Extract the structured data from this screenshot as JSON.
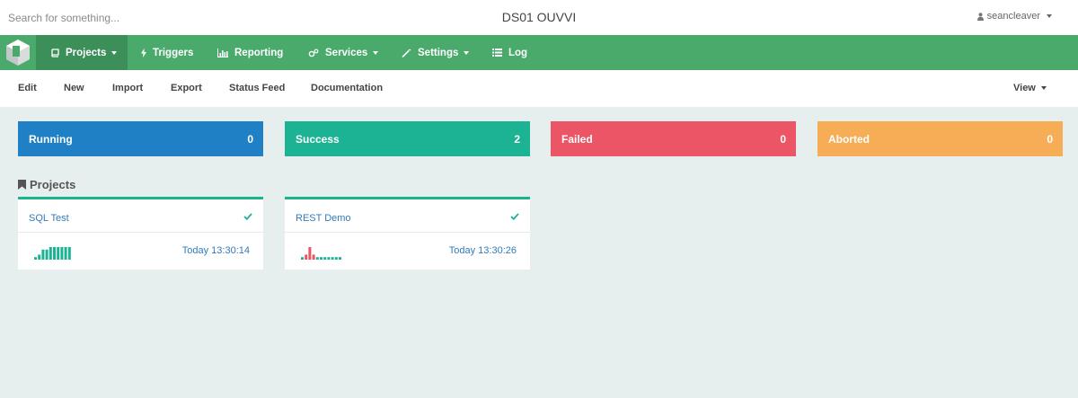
{
  "topbar": {
    "search_placeholder": "Search for something...",
    "title": "DS01 OUVVI",
    "user": "seancleaver"
  },
  "nav": {
    "items": [
      {
        "label": "Projects",
        "icon": "book-icon",
        "dropdown": true,
        "active": true
      },
      {
        "label": "Triggers",
        "icon": "bolt-icon",
        "dropdown": false
      },
      {
        "label": "Reporting",
        "icon": "bar-chart-icon",
        "dropdown": false
      },
      {
        "label": "Services",
        "icon": "cogs-icon",
        "dropdown": true
      },
      {
        "label": "Settings",
        "icon": "wand-icon",
        "dropdown": true
      },
      {
        "label": "Log",
        "icon": "list-icon",
        "dropdown": false
      }
    ]
  },
  "subnav": {
    "items": [
      "Edit",
      "New",
      "Import",
      "Export",
      "Status Feed",
      "Documentation"
    ],
    "view": "View"
  },
  "stats": [
    {
      "label": "Running",
      "count": "0",
      "color": "#1f80c5"
    },
    {
      "label": "Success",
      "count": "2",
      "color": "#1bb394"
    },
    {
      "label": "Failed",
      "count": "0",
      "color": "#ec5565"
    },
    {
      "label": "Aborted",
      "count": "0",
      "color": "#f7ad56"
    }
  ],
  "projects": {
    "title": "Projects",
    "items": [
      {
        "name": "SQL Test",
        "status": "success",
        "time": "Today 13:30:14",
        "history": [
          {
            "v": 1,
            "s": "ok"
          },
          {
            "v": 2,
            "s": "ok"
          },
          {
            "v": 4,
            "s": "ok"
          },
          {
            "v": 4,
            "s": "ok"
          },
          {
            "v": 5,
            "s": "ok"
          },
          {
            "v": 5,
            "s": "ok"
          },
          {
            "v": 5,
            "s": "ok"
          },
          {
            "v": 5,
            "s": "ok"
          },
          {
            "v": 5,
            "s": "ok"
          },
          {
            "v": 5,
            "s": "ok"
          }
        ]
      },
      {
        "name": "REST Demo",
        "status": "success",
        "time": "Today 13:30:26",
        "history": [
          {
            "v": 1,
            "s": "ok"
          },
          {
            "v": 2,
            "s": "fail"
          },
          {
            "v": 5,
            "s": "fail"
          },
          {
            "v": 2,
            "s": "fail"
          },
          {
            "v": 1,
            "s": "ok"
          },
          {
            "v": 1,
            "s": "ok"
          },
          {
            "v": 1,
            "s": "ok"
          },
          {
            "v": 1,
            "s": "ok"
          },
          {
            "v": 1,
            "s": "ok"
          },
          {
            "v": 1,
            "s": "ok"
          },
          {
            "v": 1,
            "s": "ok"
          }
        ]
      }
    ]
  },
  "colors": {
    "nav": "#49aa6c",
    "nav_active": "#3c8f58",
    "ok": "#1bb394",
    "fail": "#ec5565",
    "link": "#337ab7"
  }
}
